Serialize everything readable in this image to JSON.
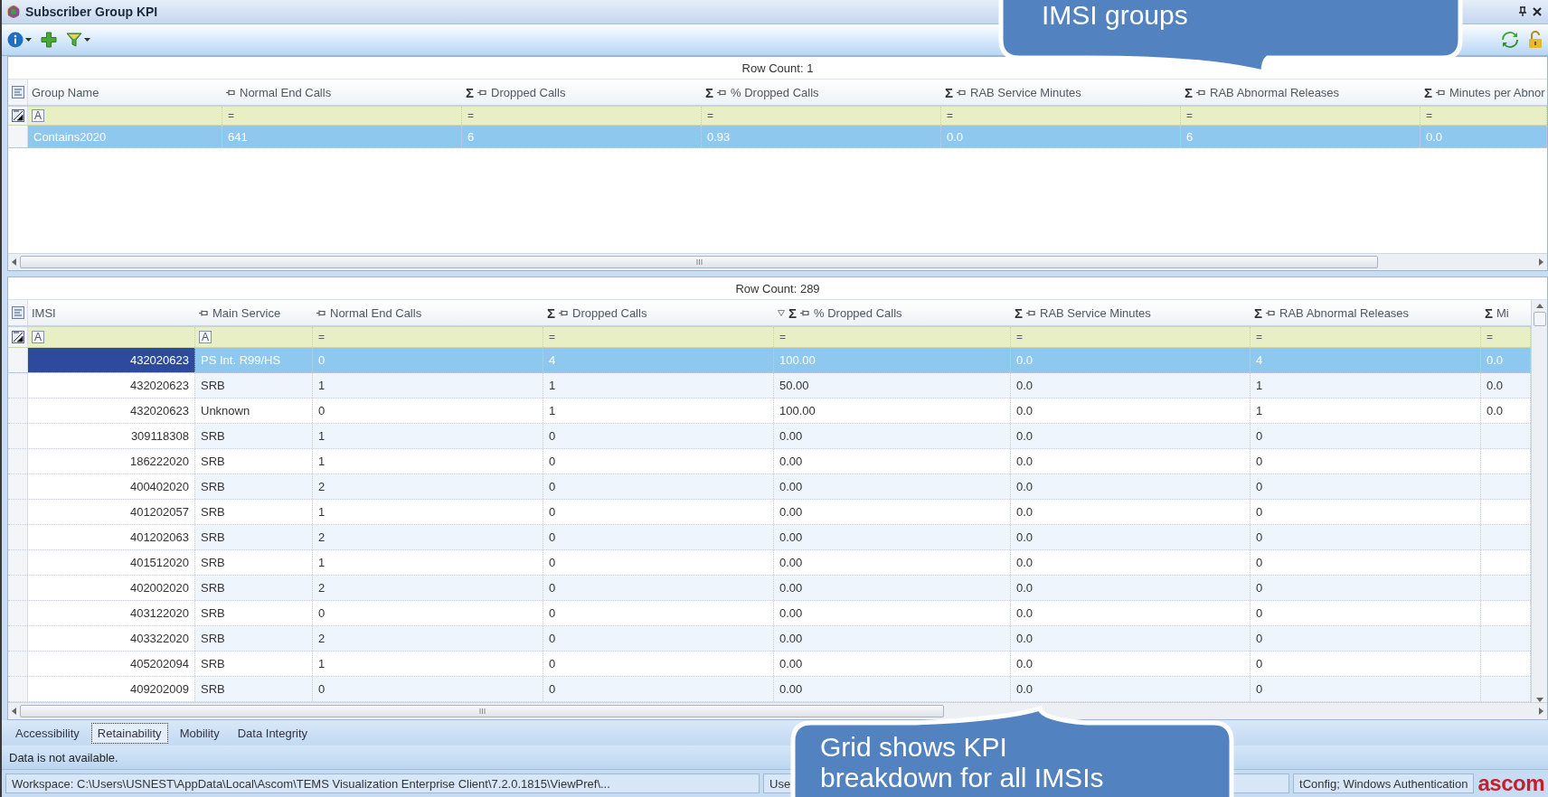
{
  "window": {
    "title": "Subscriber Group KPI"
  },
  "toolbar": {
    "left": [
      {
        "kind": "info",
        "dropdown": true
      },
      {
        "kind": "add",
        "dropdown": false
      },
      {
        "kind": "filter",
        "dropdown": true
      }
    ],
    "right": [
      {
        "kind": "refresh"
      },
      {
        "kind": "lock"
      }
    ]
  },
  "group_grid": {
    "row_count": "Row Count: 1",
    "columns": [
      {
        "label": "Group Name",
        "pin": false,
        "sorted": false,
        "filter": {
          "kind": "text",
          "symbol": "A"
        }
      },
      {
        "label": "Normal End Calls",
        "pin": true,
        "sorted": false,
        "filter": {
          "kind": "number",
          "symbol": "="
        }
      },
      {
        "label": "Dropped Calls",
        "sum": "Σ",
        "pin": true,
        "sorted": false,
        "filter": {
          "kind": "number",
          "symbol": "="
        }
      },
      {
        "label": "% Dropped Calls",
        "sum": "Σ",
        "pin": true,
        "sorted": false,
        "filter": {
          "kind": "number",
          "symbol": "="
        }
      },
      {
        "label": "RAB Service Minutes",
        "sum": "Σ",
        "pin": true,
        "sorted": false,
        "filter": {
          "kind": "number",
          "symbol": "="
        }
      },
      {
        "label": "RAB Abnormal Releases",
        "sum": "Σ",
        "pin": true,
        "sorted": false,
        "filter": {
          "kind": "number",
          "symbol": "="
        }
      },
      {
        "label": "Minutes per Abnor",
        "sum": "Σ",
        "pin": true,
        "sorted": false,
        "filter": {
          "kind": "number",
          "symbol": "="
        }
      }
    ],
    "rows": [
      {
        "selected": true,
        "cells": [
          "Contains2020",
          "641",
          "6",
          "0.93",
          "0.0",
          "6",
          "0.0"
        ]
      }
    ]
  },
  "imsi_grid": {
    "row_count": "Row Count: 289",
    "columns": [
      {
        "label": "IMSI",
        "pin": false,
        "sorted": false,
        "filter": {
          "kind": "text",
          "symbol": "A"
        }
      },
      {
        "label": "Main Service",
        "pin": true,
        "sorted": false,
        "filter": {
          "kind": "text",
          "symbol": "A"
        }
      },
      {
        "label": "Normal End Calls",
        "pin": true,
        "sorted": false,
        "filter": {
          "kind": "number",
          "symbol": "="
        }
      },
      {
        "label": "Dropped Calls",
        "sum": "Σ",
        "pin": true,
        "sorted": false,
        "filter": {
          "kind": "number",
          "symbol": "="
        }
      },
      {
        "label": "% Dropped Calls",
        "sum": "Σ",
        "pin": true,
        "sorted": true,
        "filter": {
          "kind": "number",
          "symbol": "="
        }
      },
      {
        "label": "RAB Service Minutes",
        "sum": "Σ",
        "pin": true,
        "sorted": false,
        "filter": {
          "kind": "number",
          "symbol": "="
        }
      },
      {
        "label": "RAB Abnormal Releases",
        "sum": "Σ",
        "pin": true,
        "sorted": false,
        "filter": {
          "kind": "number",
          "symbol": "="
        }
      },
      {
        "label": "Mi",
        "sum": "Σ",
        "pin": false,
        "sorted": false,
        "filter": {
          "kind": "number",
          "symbol": "="
        }
      }
    ],
    "rows": [
      {
        "selected": true,
        "cells": [
          "432020623",
          "PS Int. R99/HS",
          "0",
          "4",
          "100.00",
          "0.0",
          "4",
          "0.0"
        ]
      },
      {
        "selected": false,
        "cells": [
          "432020623",
          "SRB",
          "1",
          "1",
          "50.00",
          "0.0",
          "1",
          "0.0"
        ]
      },
      {
        "selected": false,
        "cells": [
          "432020623",
          "Unknown",
          "0",
          "1",
          "100.00",
          "0.0",
          "1",
          "0.0"
        ]
      },
      {
        "selected": false,
        "cells": [
          "309118308",
          "SRB",
          "1",
          "0",
          "0.00",
          "0.0",
          "0"
        ]
      },
      {
        "selected": false,
        "cells": [
          "186222020",
          "SRB",
          "1",
          "0",
          "0.00",
          "0.0",
          "0"
        ]
      },
      {
        "selected": false,
        "cells": [
          "400402020",
          "SRB",
          "2",
          "0",
          "0.00",
          "0.0",
          "0"
        ]
      },
      {
        "selected": false,
        "cells": [
          "401202057",
          "SRB",
          "1",
          "0",
          "0.00",
          "0.0",
          "0"
        ]
      },
      {
        "selected": false,
        "cells": [
          "401202063",
          "SRB",
          "2",
          "0",
          "0.00",
          "0.0",
          "0"
        ]
      },
      {
        "selected": false,
        "cells": [
          "401512020",
          "SRB",
          "1",
          "0",
          "0.00",
          "0.0",
          "0"
        ]
      },
      {
        "selected": false,
        "cells": [
          "402002020",
          "SRB",
          "2",
          "0",
          "0.00",
          "0.0",
          "0"
        ]
      },
      {
        "selected": false,
        "cells": [
          "403122020",
          "SRB",
          "0",
          "0",
          "0.00",
          "0.0",
          "0"
        ]
      },
      {
        "selected": false,
        "cells": [
          "403322020",
          "SRB",
          "2",
          "0",
          "0.00",
          "0.0",
          "0"
        ]
      },
      {
        "selected": false,
        "cells": [
          "405202094",
          "SRB",
          "1",
          "0",
          "0.00",
          "0.0",
          "0"
        ]
      },
      {
        "selected": false,
        "cells": [
          "409202009",
          "SRB",
          "0",
          "0",
          "0.00",
          "0.0",
          "0"
        ]
      }
    ]
  },
  "tabs": [
    {
      "label": "Accessibility",
      "selected": false
    },
    {
      "label": "Retainability",
      "selected": true
    },
    {
      "label": "Mobility",
      "selected": false
    },
    {
      "label": "Data Integrity",
      "selected": false
    }
  ],
  "message": "Data is not available.",
  "status_bar": {
    "segments": [
      "Workspace: C:\\Users\\USNEST\\AppData\\Local\\Ascom\\TEMS Visualization Enterprise Client\\7.2.0.1815\\ViewPref\\...",
      "Use",
      "tConfig; Windows Authentication"
    ],
    "logo": "ascom"
  },
  "callouts": [
    {
      "kind": "top",
      "lines": [
        "IMSI groups"
      ]
    },
    {
      "kind": "bottom",
      "lines": [
        "Grid shows KPI",
        "breakdown for all IMSIs"
      ]
    }
  ]
}
